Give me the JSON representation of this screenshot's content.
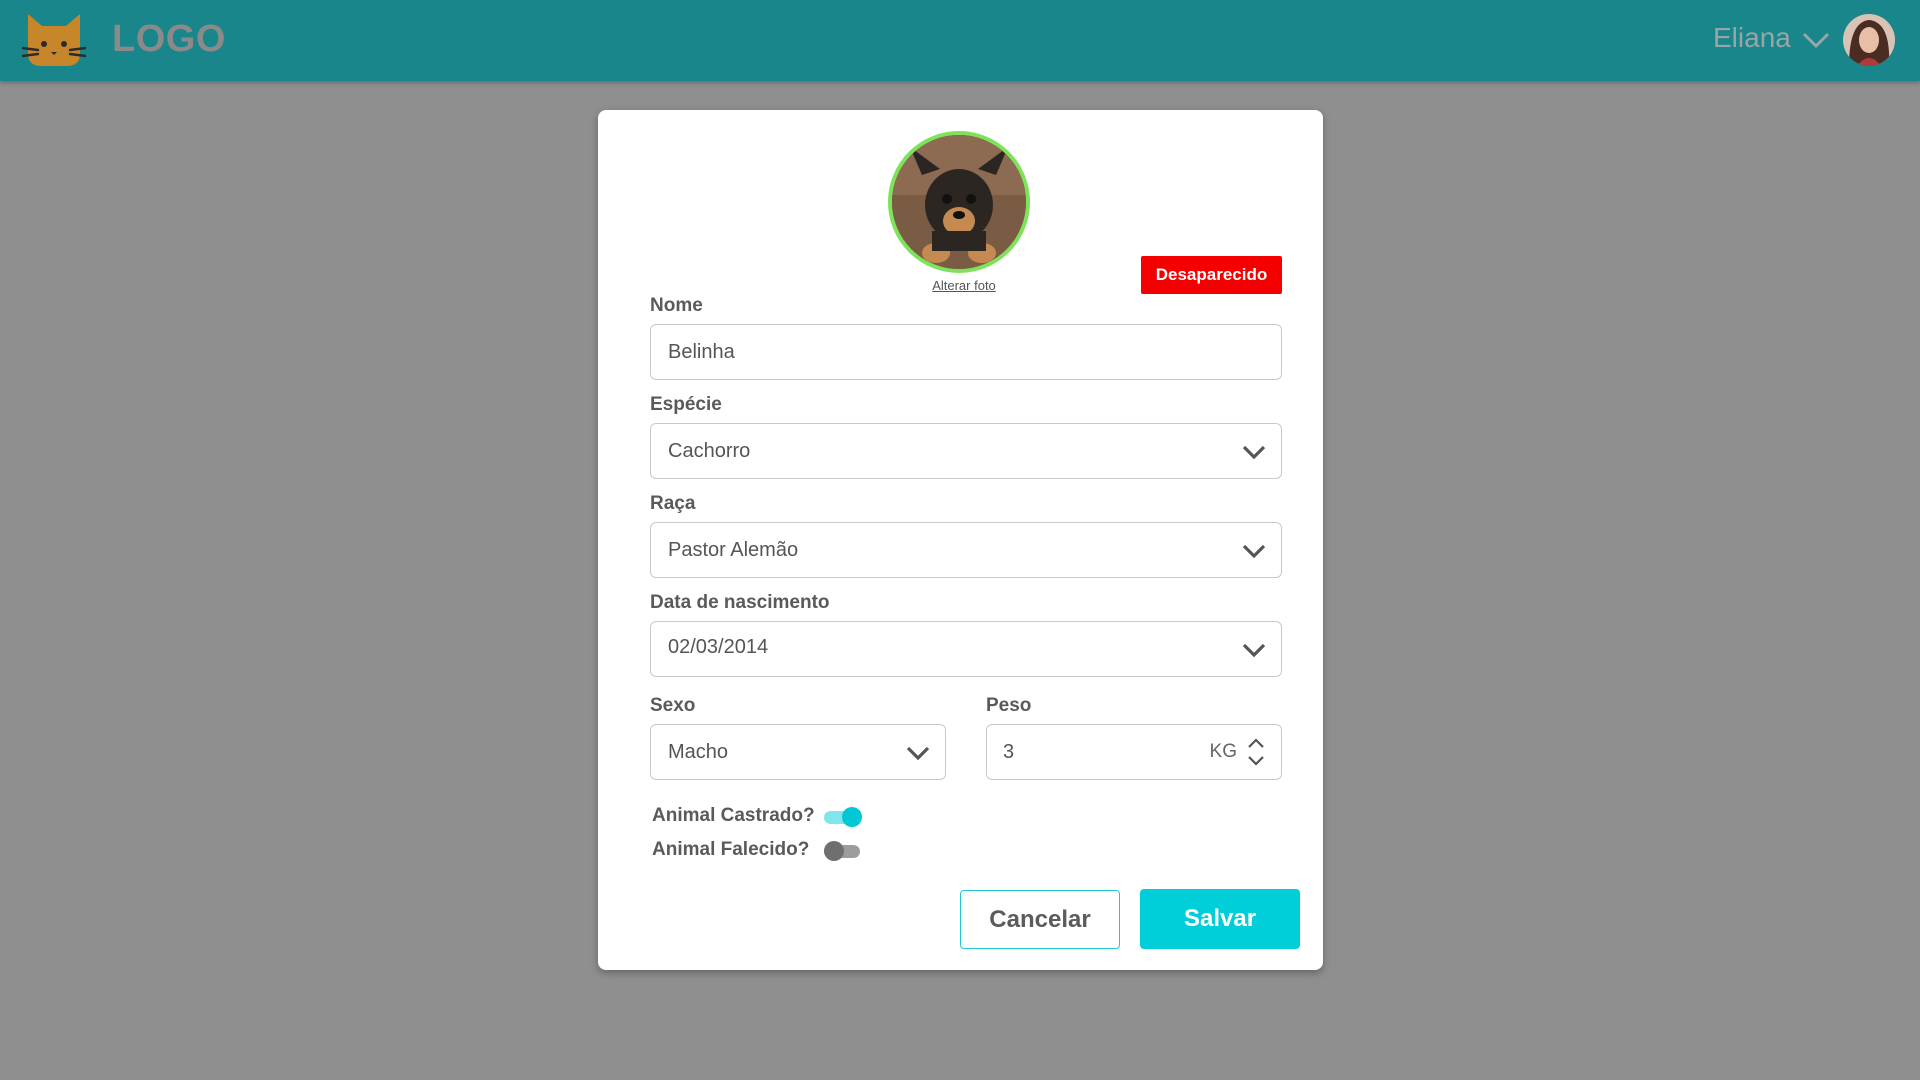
{
  "header": {
    "logo_text": "LOGO",
    "user_name": "Eliana"
  },
  "form": {
    "change_photo_link": "Alterar foto",
    "status_badge": "Desaparecido",
    "name": {
      "label": "Nome",
      "value": "Belinha"
    },
    "species": {
      "label": "Espécie",
      "value": "Cachorro"
    },
    "breed": {
      "label": "Raça",
      "value": "Pastor Alemão"
    },
    "birth_date": {
      "label": "Data de nascimento",
      "value": "02/03/2014"
    },
    "sex": {
      "label": "Sexo",
      "value": "Macho"
    },
    "weight": {
      "label": "Peso",
      "value": "3",
      "unit": "KG"
    },
    "neutered": {
      "label": "Animal Castrado?",
      "checked": true
    },
    "deceased": {
      "label": "Animal Falecido?",
      "checked": false
    },
    "cancel_label": "Cancelar",
    "save_label": "Salvar"
  },
  "colors": {
    "header": "#18868a",
    "accent": "#00ced9",
    "badge": "#f50000",
    "photo_border": "#7ee35a"
  }
}
